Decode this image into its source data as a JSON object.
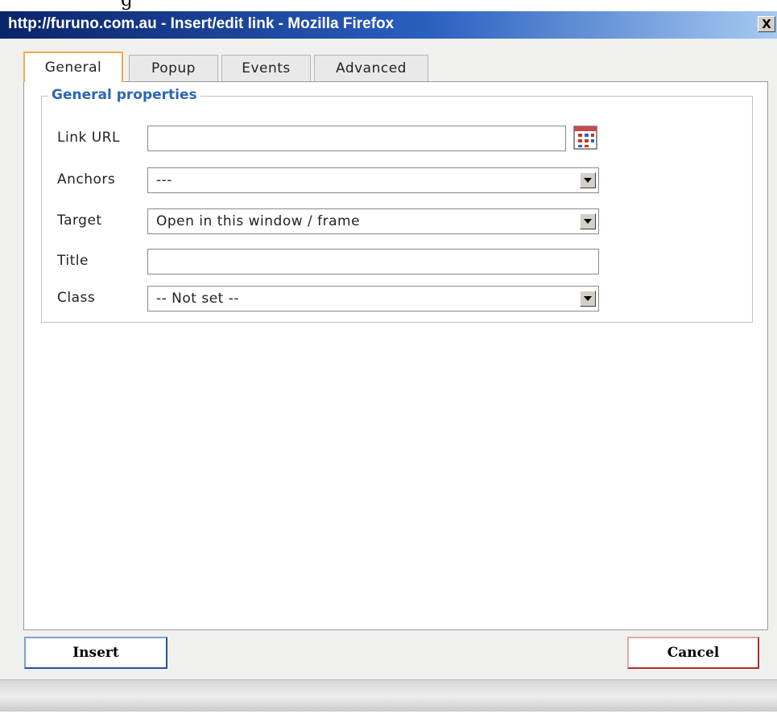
{
  "background_text": "g",
  "window": {
    "title": "http://furuno.com.au - Insert/edit link - Mozilla Firefox",
    "close_label": "X"
  },
  "tabs": [
    {
      "label": "General",
      "active": true
    },
    {
      "label": "Popup",
      "active": false
    },
    {
      "label": "Events",
      "active": false
    },
    {
      "label": "Advanced",
      "active": false
    }
  ],
  "general": {
    "legend": "General properties",
    "link_url": {
      "label": "Link URL",
      "value": ""
    },
    "anchors": {
      "label": "Anchors",
      "value": "---"
    },
    "target": {
      "label": "Target",
      "value": "Open in this window / frame"
    },
    "title": {
      "label": "Title",
      "value": ""
    },
    "class": {
      "label": "Class",
      "value": "-- Not set --"
    }
  },
  "buttons": {
    "insert": "Insert",
    "cancel": "Cancel"
  },
  "colors": {
    "accent_blue": "#2b66b3",
    "active_tab_border": "#f5a94a",
    "titlebar": "#0a246a"
  }
}
